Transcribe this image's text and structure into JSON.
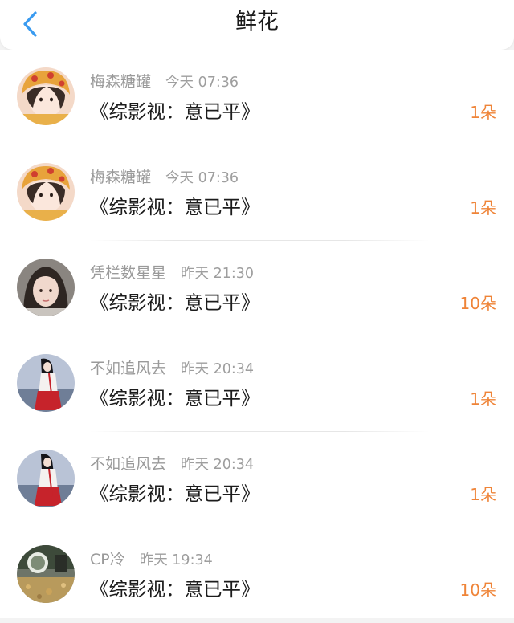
{
  "header": {
    "title": "鲜花",
    "back_icon": "chevron-left-icon",
    "accent": "#3a9bf0"
  },
  "colors": {
    "count": "#ef8438",
    "meta": "#9a9a9a"
  },
  "items": [
    {
      "user": "梅森糖罐",
      "time": "今天 07:36",
      "work": "《综影视：意已平》",
      "count": "1朵",
      "avatar": "avatar-girl-strawberry-hat"
    },
    {
      "user": "梅森糖罐",
      "time": "今天 07:36",
      "work": "《综影视：意已平》",
      "count": "1朵",
      "avatar": "avatar-girl-strawberry-hat"
    },
    {
      "user": "凭栏数星星",
      "time": "昨天 21:30",
      "work": "《综影视：意已平》",
      "count": "10朵",
      "avatar": "avatar-girl-portrait"
    },
    {
      "user": "不如追风去",
      "time": "昨天 20:34",
      "work": "《综影视：意已平》",
      "count": "1朵",
      "avatar": "avatar-hanfu-figure"
    },
    {
      "user": "不如追风去",
      "time": "昨天 20:34",
      "work": "《综影视：意已平》",
      "count": "1朵",
      "avatar": "avatar-hanfu-figure"
    },
    {
      "user": "CP冷",
      "time": "昨天 19:34",
      "work": "《综影视：意已平》",
      "count": "10朵",
      "avatar": "avatar-garden-scene"
    }
  ]
}
